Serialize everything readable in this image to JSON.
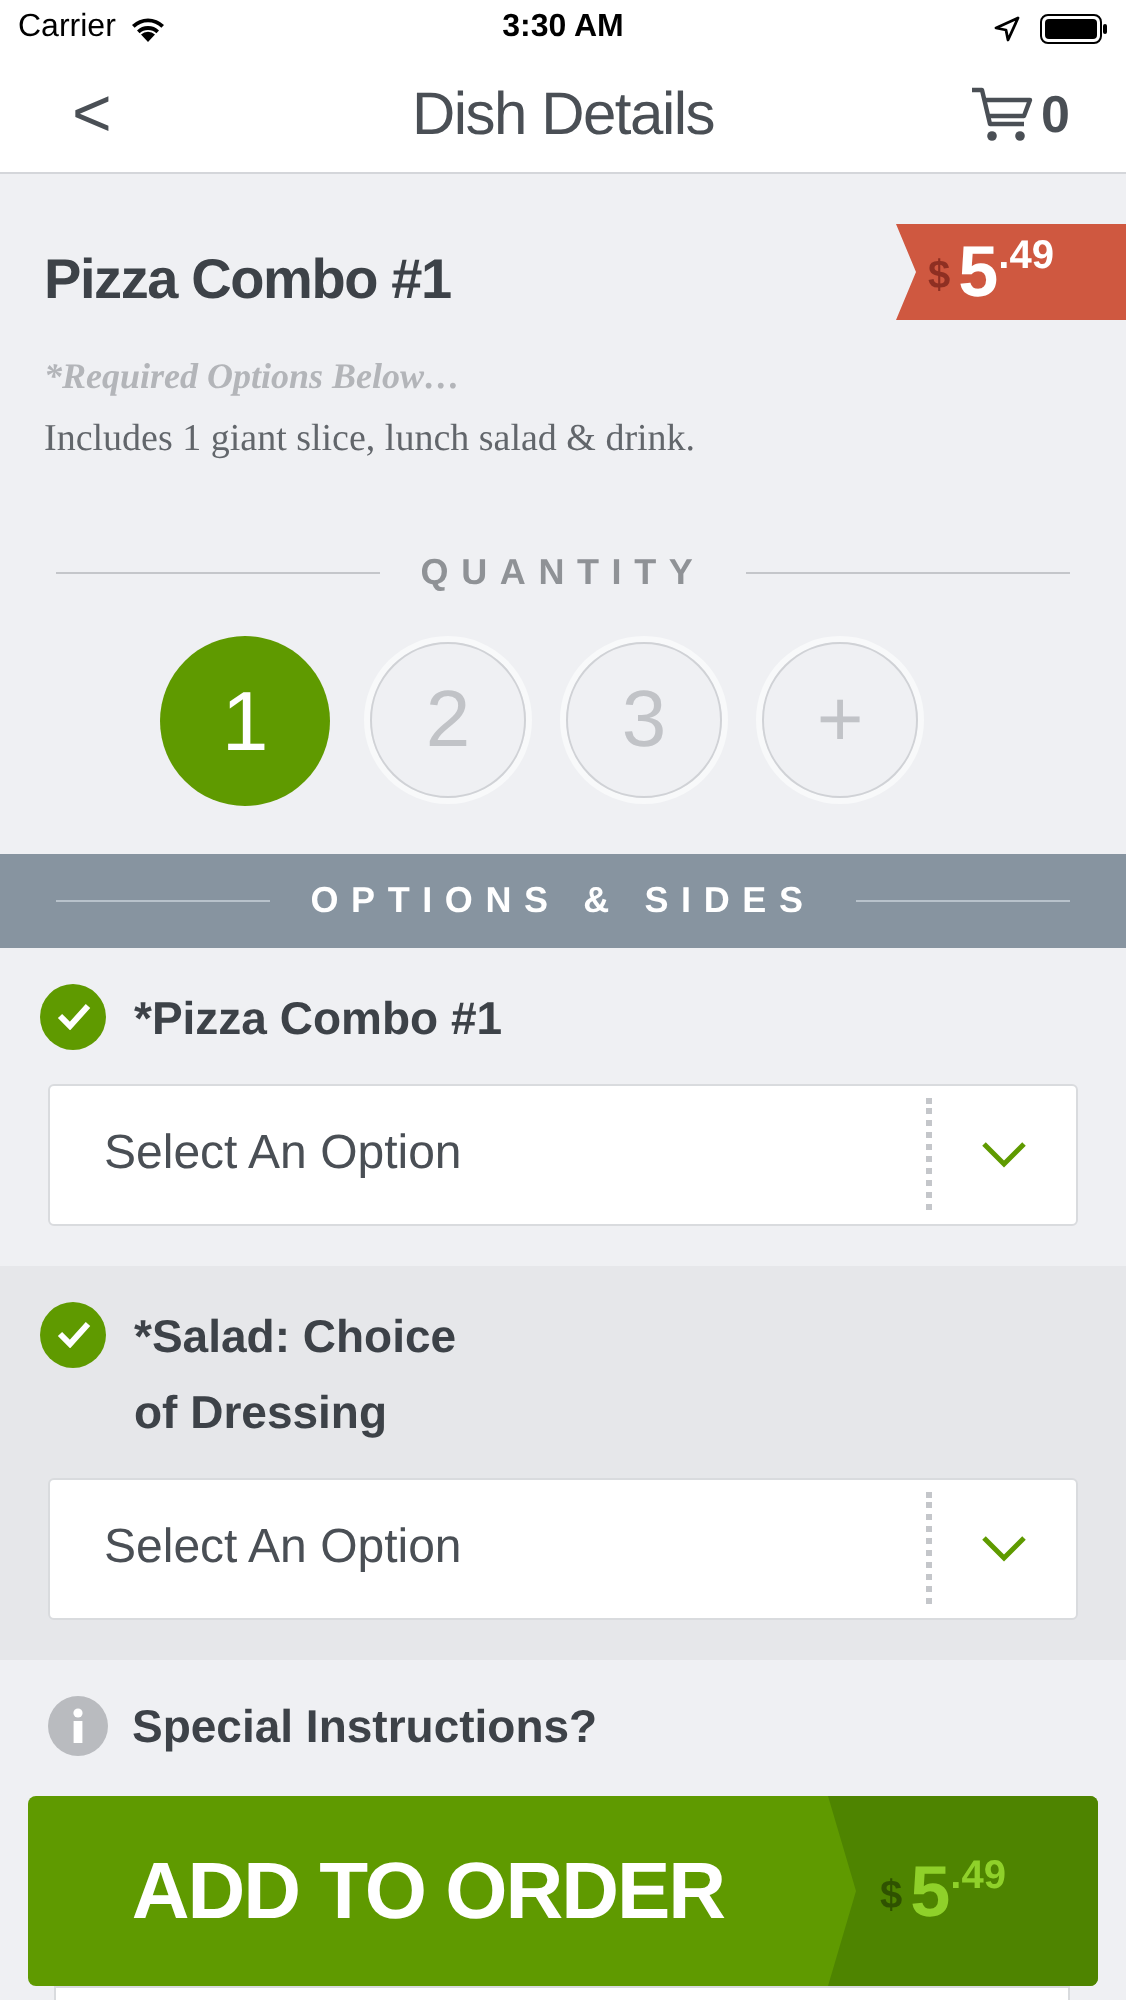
{
  "status_bar": {
    "carrier": "Carrier",
    "time": "3:30 AM"
  },
  "nav": {
    "back": "<",
    "title": "Dish Details",
    "cart_count": "0"
  },
  "dish": {
    "name": "Pizza Combo #1",
    "price": {
      "currency": "$",
      "whole": "5",
      "cents": ".49"
    },
    "note": "*Required Options Below…",
    "description": "Includes 1 giant slice, lunch salad & drink."
  },
  "quantity": {
    "heading": "QUANTITY",
    "options": [
      {
        "label": "1",
        "selected": true
      },
      {
        "label": "2",
        "selected": false
      },
      {
        "label": "3",
        "selected": false
      },
      {
        "label": "+",
        "selected": false
      }
    ]
  },
  "options_heading": "OPTIONS & SIDES",
  "option_groups": [
    {
      "label": "*Pizza Combo #1",
      "checked": true,
      "placeholder": "Select An Option"
    },
    {
      "label": "*Salad: Choice of Dressing",
      "checked": true,
      "placeholder": "Select An Option"
    }
  ],
  "special_instructions": "Special Instructions?",
  "add_button": {
    "label": "ADD TO ORDER",
    "price": {
      "currency": "$",
      "whole": "5",
      "cents": ".49"
    }
  }
}
